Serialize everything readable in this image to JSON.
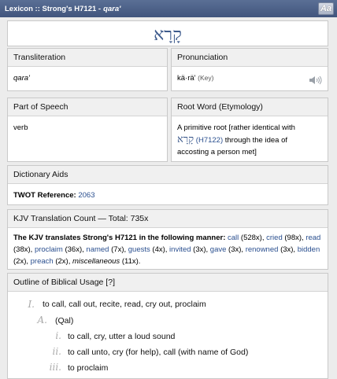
{
  "titlebar": {
    "prefix": "Lexicon :: Strong's H7121 - ",
    "word": "qara'",
    "font_button": "Aa"
  },
  "headword": "קָרָא",
  "transliteration": {
    "heading": "Transliteration",
    "value": "qara'"
  },
  "pronunciation": {
    "heading": "Pronunciation",
    "value": "kä·rä'",
    "key": "(Key)"
  },
  "part_of_speech": {
    "heading": "Part of Speech",
    "value": "verb"
  },
  "root_word": {
    "heading": "Root Word (Etymology)",
    "text1": "A primitive root [rather identical with",
    "hebrew": "קָרָא",
    "ref": "(H7122)",
    "text2": " through the idea of",
    "text3": "accosting a person met]"
  },
  "dictionary_aids": {
    "heading": "Dictionary Aids",
    "label": "TWOT Reference:",
    "value": "2063"
  },
  "kjv": {
    "heading": "KJV Translation Count — Total: 735x",
    "intro": "The KJV translates Strong's H7121 in the following manner:",
    "items": [
      {
        "word": "call",
        "count": "(528x),"
      },
      {
        "word": "cried",
        "count": "(98x),"
      },
      {
        "word": "read",
        "count": "(38x),"
      },
      {
        "word": "proclaim",
        "count": "(36x),"
      },
      {
        "word": "named",
        "count": "(7x),"
      },
      {
        "word": "guests",
        "count": "(4x),"
      },
      {
        "word": "invited",
        "count": "(3x),"
      },
      {
        "word": "gave",
        "count": "(3x),"
      },
      {
        "word": "renowned",
        "count": "(3x),"
      },
      {
        "word": "bidden",
        "count": "(2x),"
      },
      {
        "word": "preach",
        "count": "(2x),"
      },
      {
        "word": "miscellaneous",
        "count": "(11x)."
      }
    ]
  },
  "outline": {
    "heading": "Outline of Biblical Usage [?]",
    "rows": [
      {
        "marker": "I.",
        "text": "to call, call out, recite, read, cry out, proclaim"
      },
      {
        "marker": "A.",
        "text": "(Qal)"
      },
      {
        "marker": "i.",
        "text": "to call, cry, utter a loud sound"
      },
      {
        "marker": "ii.",
        "text": "to call unto, cry (for help), call (with name of God)"
      },
      {
        "marker": "iii.",
        "text": "to proclaim"
      }
    ]
  }
}
